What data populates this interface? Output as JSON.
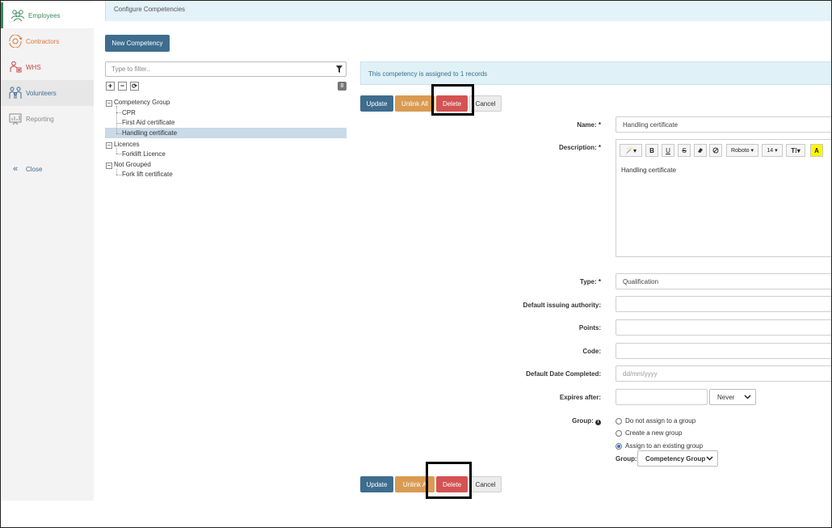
{
  "sidebar": {
    "items": [
      {
        "label": "Employees",
        "icon": "employees-icon",
        "color": "#3c8a5a"
      },
      {
        "label": "Contractors",
        "icon": "contractors-icon",
        "color": "#d9783a"
      },
      {
        "label": "WHS",
        "icon": "whs-icon",
        "color": "#c9423c"
      },
      {
        "label": "Volunteers",
        "icon": "volunteers-icon",
        "color": "#3e6d8e"
      },
      {
        "label": "Reporting",
        "icon": "reporting-icon",
        "color": "#8a8a8a"
      }
    ],
    "close_label": "Close"
  },
  "header": {
    "title": "Configure Competencies"
  },
  "toolbar": {
    "new_label": "New Competency"
  },
  "filter": {
    "placeholder": "Type to filter.."
  },
  "tree": {
    "expand": "+",
    "collapse": "−",
    "refresh": "⟳",
    "count": "8",
    "groups": [
      {
        "label": "Competency Group",
        "children": [
          "CPR",
          "First Aid certificate",
          "Handling certificate"
        ]
      },
      {
        "label": "Licences",
        "children": [
          "Forklift Licence"
        ]
      },
      {
        "label": "Not Grouped",
        "children": [
          "Fork lift certificate"
        ]
      }
    ]
  },
  "info": {
    "message": "This competency is assigned to 1 records"
  },
  "actions": {
    "update": "Update",
    "unlink_all": "Unlink All",
    "unlink_all_truncated": "Unlink A",
    "delete": "Delete",
    "cancel": "Cancel"
  },
  "form": {
    "name_label": "Name: *",
    "name_value": "Handling certificate",
    "description_label": "Description: *",
    "description_value": "Handling certificate",
    "editor": {
      "magic": "🪄▾",
      "bold": "B",
      "underline": "U",
      "strike": "S",
      "font": "Roboto ▾",
      "size": "14 ▾",
      "text_size": "T⁞▾",
      "highlight": "A"
    },
    "type_label": "Type: *",
    "type_value": "Qualification",
    "issuing_label": "Default issuing authority:",
    "points_label": "Points:",
    "code_label": "Code:",
    "date_label": "Default Date Completed:",
    "date_placeholder": "dd/mm/yyyy",
    "expires_label": "Expires after:",
    "expires_unit": "Never",
    "group_label": "Group:",
    "group_options": [
      "Do not assign to a group",
      "Create a new group",
      "Assign to an existing group"
    ],
    "group_select_label": "Group:",
    "group_select_value": "Competency Group"
  }
}
